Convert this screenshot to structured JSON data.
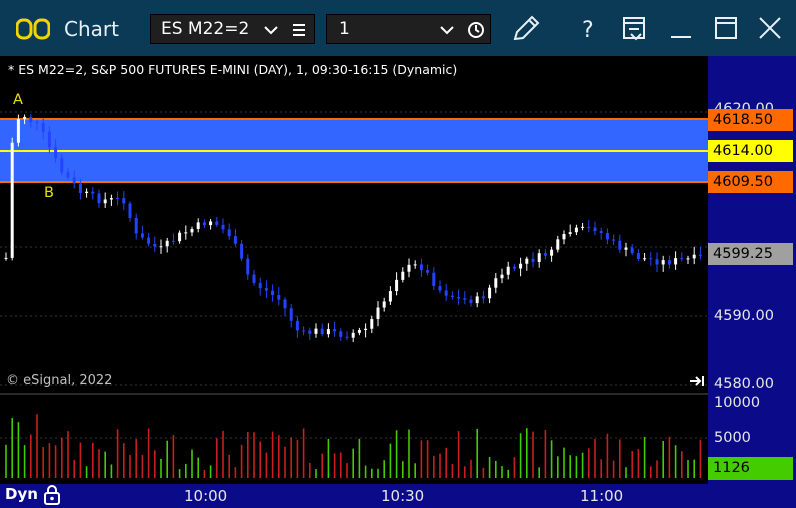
{
  "window": {
    "title": "Chart",
    "symbol": "ES M22=2",
    "interval": "1",
    "controls": [
      "edit-icon",
      "help-icon",
      "layout-icon",
      "minimize-icon",
      "maximize-icon",
      "close-icon"
    ]
  },
  "chart": {
    "info_line": "* ES M22=2, S&P 500 FUTURES E-MINI (DAY), 1, 09:30-16:15 (Dynamic)",
    "copyright": "© eSignal, 2022",
    "markers": {
      "a": "A",
      "b": "B"
    },
    "price_labels": [
      "4620.00",
      "4590.00",
      "4580.00"
    ],
    "price_tags": {
      "upper": {
        "text": "4618.50",
        "bg": "#ff6a00",
        "fg": "#000000"
      },
      "mid": {
        "text": "4614.00",
        "bg": "#ffff00",
        "fg": "#000000"
      },
      "lower": {
        "text": "4609.50",
        "bg": "#ff6a00",
        "fg": "#000000"
      },
      "last": {
        "text": "4599.25",
        "bg": "#a0a0a0",
        "fg": "#000000"
      }
    },
    "volume_labels": [
      "10000",
      "5000"
    ],
    "volume_tag": {
      "text": "1126",
      "bg": "#44cc00",
      "fg": "#000000"
    },
    "time_labels": [
      "10:00",
      "10:30",
      "11:00"
    ],
    "footer_mode": "Dyn",
    "zone_color": "#3366ff"
  }
}
